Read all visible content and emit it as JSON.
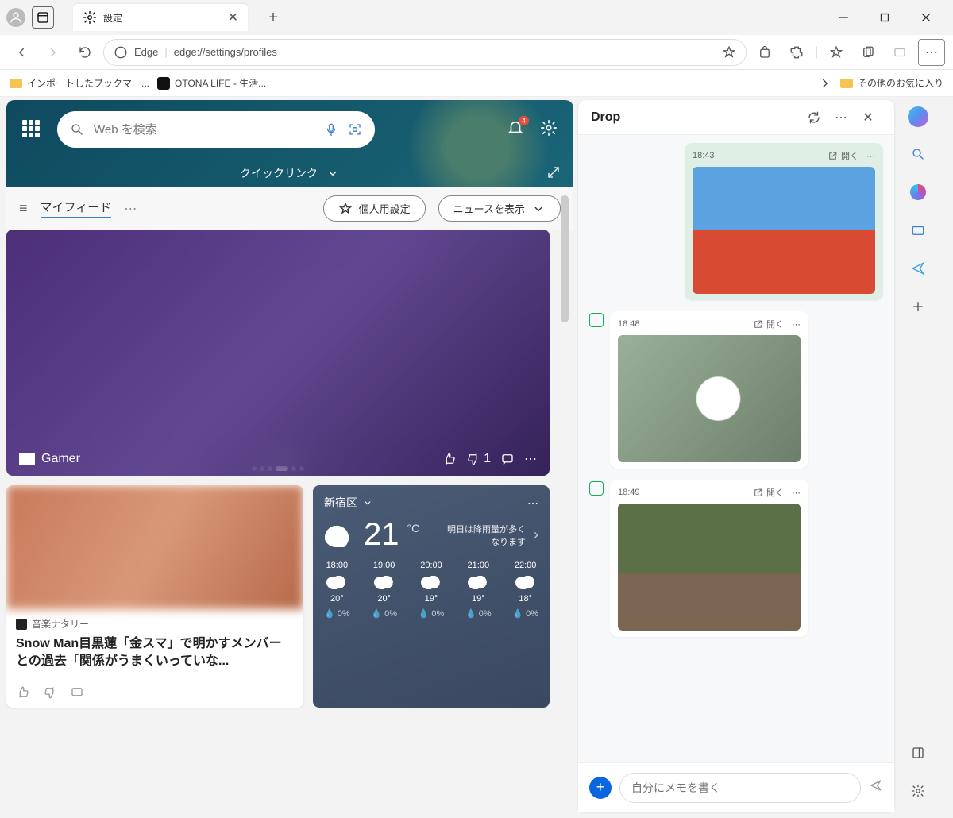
{
  "titlebar": {
    "tab_title": "設定"
  },
  "toolbar": {
    "edge_label": "Edge",
    "url": "edge://settings/profiles"
  },
  "bookmarks": {
    "imported": "インポートしたブックマー...",
    "otona": "OTONA LIFE - 生活...",
    "others": "その他のお気に入り"
  },
  "hero": {
    "search_placeholder": "Web を検索",
    "quick_links": "クイックリンク",
    "bell_badge": "4"
  },
  "feed": {
    "title": "マイフィード",
    "personalize": "個人用設定",
    "show_news": "ニュースを表示"
  },
  "bigcard": {
    "source": "Gamer",
    "dislike_count": "1"
  },
  "news": {
    "source": "音楽ナタリー",
    "title": "Snow Man目黒蓮「金スマ」で明かすメンバーとの過去「関係がうまくいっていな..."
  },
  "weather": {
    "location": "新宿区",
    "temp": "21",
    "unit": "°C",
    "note": "明日は降雨量が多くなります",
    "hours": [
      {
        "t": "18:00",
        "temp": "20°",
        "p": "0%"
      },
      {
        "t": "19:00",
        "temp": "20°",
        "p": "0%"
      },
      {
        "t": "20:00",
        "temp": "19°",
        "p": "0%"
      },
      {
        "t": "21:00",
        "temp": "19°",
        "p": "0%"
      },
      {
        "t": "22:00",
        "temp": "18°",
        "p": "0%"
      }
    ]
  },
  "drop": {
    "title": "Drop",
    "open_label": "開く",
    "msgs": [
      {
        "time": "18:43"
      },
      {
        "time": "18:48"
      },
      {
        "time": "18:49"
      }
    ],
    "input_placeholder": "自分にメモを書く"
  }
}
